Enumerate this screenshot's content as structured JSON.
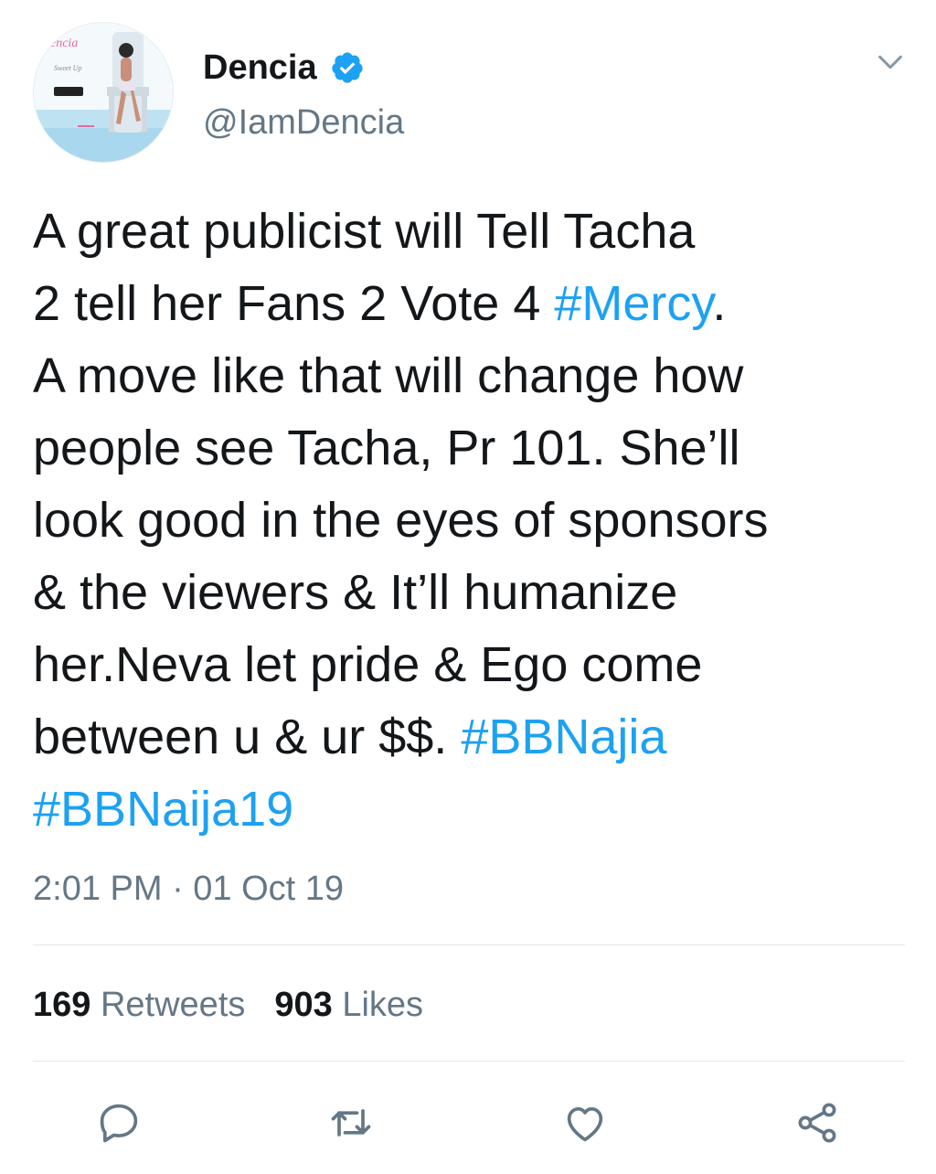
{
  "tweet": {
    "author": {
      "name": "Dencia",
      "handle": "@IamDencia",
      "verified": true,
      "avatar_icon": "profile-photo"
    },
    "text_lines": [
      [
        {
          "t": "A great publicist will Tell Tacha",
          "tag": false
        }
      ],
      [
        {
          "t": "2 tell her Fans 2 Vote 4 ",
          "tag": false
        },
        {
          "t": "#Mercy",
          "tag": true
        },
        {
          "t": ".",
          "tag": false
        }
      ],
      [
        {
          "t": "A move like that will change how",
          "tag": false
        }
      ],
      [
        {
          "t": "people see Tacha, Pr 101. She’ll",
          "tag": false
        }
      ],
      [
        {
          "t": "look good in the eyes of sponsors",
          "tag": false
        }
      ],
      [
        {
          "t": "& the viewers & It’ll humanize",
          "tag": false
        }
      ],
      [
        {
          "t": "her.Neva let pride & Ego come",
          "tag": false
        }
      ],
      [
        {
          "t": "between u & ur $$. ",
          "tag": false
        },
        {
          "t": "#BBNajia",
          "tag": true
        }
      ],
      [
        {
          "t": "#BBNaija19",
          "tag": true
        }
      ]
    ],
    "timestamp": "2:01 PM · 01 Oct 19",
    "stats": {
      "retweets_count": "169",
      "retweets_label": "Retweets",
      "likes_count": "903",
      "likes_label": "Likes"
    },
    "actions": {
      "reply_icon": "reply-icon",
      "retweet_icon": "retweet-icon",
      "like_icon": "heart-icon",
      "share_icon": "share-icon"
    },
    "menu_icon": "chevron-down-icon"
  },
  "colors": {
    "text": "#14171a",
    "secondary": "#657786",
    "link": "#1da1f2",
    "divider": "#e1e8ed",
    "icon": "#657786",
    "verified": "#1da1f2"
  }
}
